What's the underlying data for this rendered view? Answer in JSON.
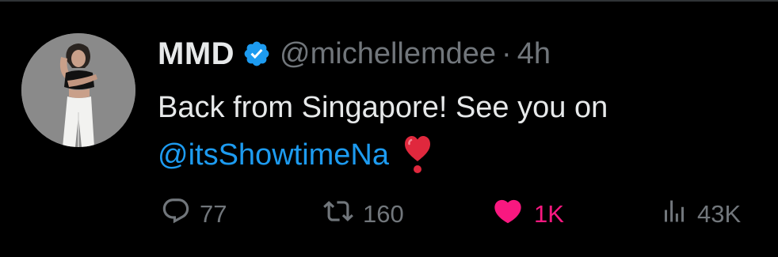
{
  "user": {
    "display_name": "MMD",
    "handle": "@michellemdee",
    "separator": "·",
    "time": "4h",
    "verified": true
  },
  "tweet": {
    "text_line1": "Back from Singapore! See you on",
    "mention": "@itsShowtimeNa",
    "emoji": "heavy-red-heart-exclamation"
  },
  "actions": {
    "replies": "77",
    "retweets": "160",
    "likes": "1K",
    "views": "43K"
  },
  "colors": {
    "background": "#000000",
    "text": "#e7e9ea",
    "muted": "#71767b",
    "link": "#1d9bf0",
    "like": "#f91880",
    "verified": "#1d9bf0"
  }
}
